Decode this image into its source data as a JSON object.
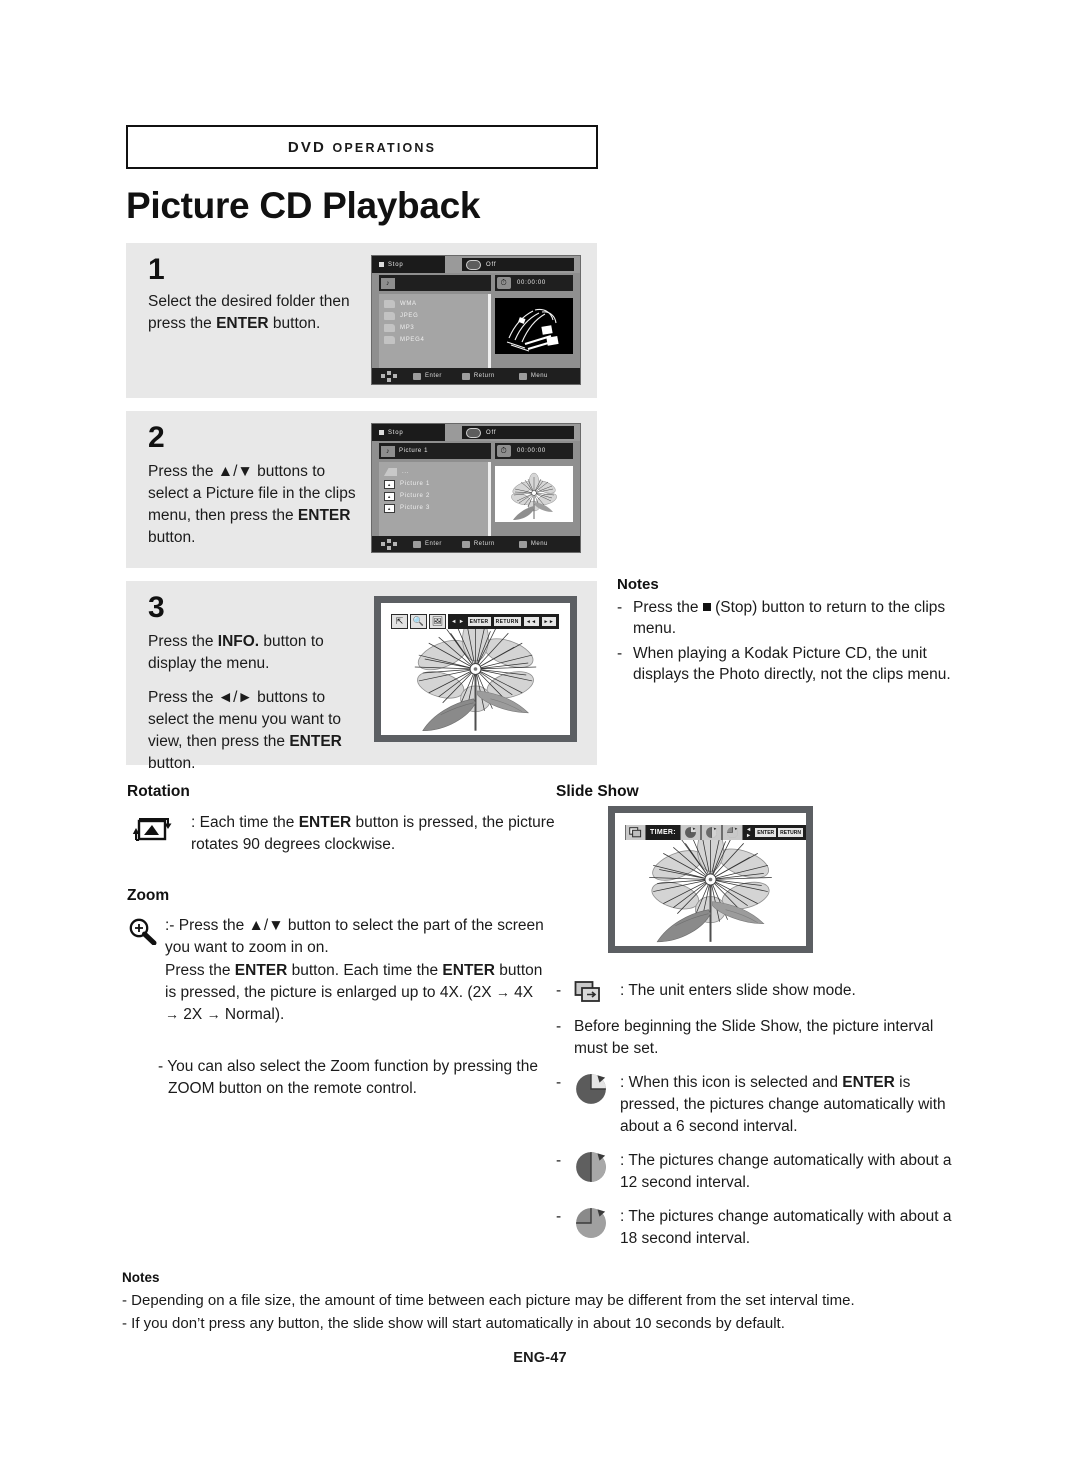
{
  "header": {
    "breadcrumb_prefix": "DVD ",
    "breadcrumb_suffix": "OPERATIONS",
    "page_title": "Picture CD Playback"
  },
  "steps": [
    {
      "number": "1",
      "lines": [
        "Select the desired folder then press the ENTER button."
      ],
      "screen": {
        "status": "Stop",
        "repeat": "Off",
        "title": "",
        "time": "00:00:00",
        "items": [
          "WMA",
          "JPEG",
          "MP3",
          "MPEG4"
        ],
        "bottom": [
          "Enter",
          "Return",
          "Menu"
        ]
      }
    },
    {
      "number": "2",
      "lines": [
        "Press the ▲/▼ buttons to select a Picture file in the clips menu, then press the ENTER button."
      ],
      "screen": {
        "status": "Stop",
        "repeat": "Off",
        "title": "Picture 1",
        "time": "00:00:00",
        "items": [
          "...",
          "Picture 1",
          "Picture 2",
          "Picture 3"
        ],
        "bottom": [
          "Enter",
          "Return",
          "Menu"
        ]
      }
    },
    {
      "number": "3",
      "lines": [
        "Press the INFO. button to display the menu.",
        "Press the ◄/► buttons to select the menu you want to view, then press the ENTER button."
      ],
      "overlay": {
        "icons": [
          "rotate-icon",
          "zoom-icon",
          "slideshow-icon"
        ],
        "nav": "◄ ►",
        "enter": "ENTER",
        "return": "RETURN",
        "skip_prev": "◄◄",
        "skip_next": "►►"
      }
    }
  ],
  "notes_right": {
    "title": "Notes",
    "items": [
      "Press the ■ (Stop) button to return to the clips menu.",
      "When playing a Kodak Picture CD, the unit displays the Photo directly, not the clips menu."
    ]
  },
  "rotation": {
    "heading": "Rotation",
    "text": ": Each time the ENTER button is pressed, the picture rotates 90 degrees clockwise."
  },
  "zoom": {
    "heading": "Zoom",
    "text": ":- Press the ▲/▼ button to select the part of the screen you want to zoom in on. Press the ENTER button. Each time the ENTER button is pressed, the picture is enlarged up to 4X. (2X → 4X → 2X → Normal).",
    "note": "- You can also select the Zoom function by pressing the ZOOM button on the remote control."
  },
  "slideshow": {
    "heading": "Slide Show",
    "screen": {
      "timer_label": "TIMER:",
      "nav": "◄ ►",
      "enter": "ENTER",
      "return": "RETURN"
    },
    "items": [
      {
        "icon": "slideshow-icon",
        "text": ": The unit enters slide show mode."
      },
      {
        "icon": "",
        "text": "Before beginning the Slide Show, the picture interval must be set."
      },
      {
        "icon": "timer-6s-icon",
        "text": ": When this icon is selected and ENTER is pressed, the pictures change automatically with about a 6 second interval."
      },
      {
        "icon": "timer-12s-icon",
        "text": ": The pictures change automatically with about a 12 second interval."
      },
      {
        "icon": "timer-18s-icon",
        "text": ": The pictures change automatically with about a 18 second interval."
      }
    ]
  },
  "notes_bottom": {
    "title": "Notes",
    "items": [
      "- Depending on a file size, the amount of time between each picture may be different from the set interval time.",
      "- If you don’t press any button, the slide show will start automatically in about 10 seconds by default."
    ]
  },
  "footer": {
    "page_label": "ENG-47"
  }
}
